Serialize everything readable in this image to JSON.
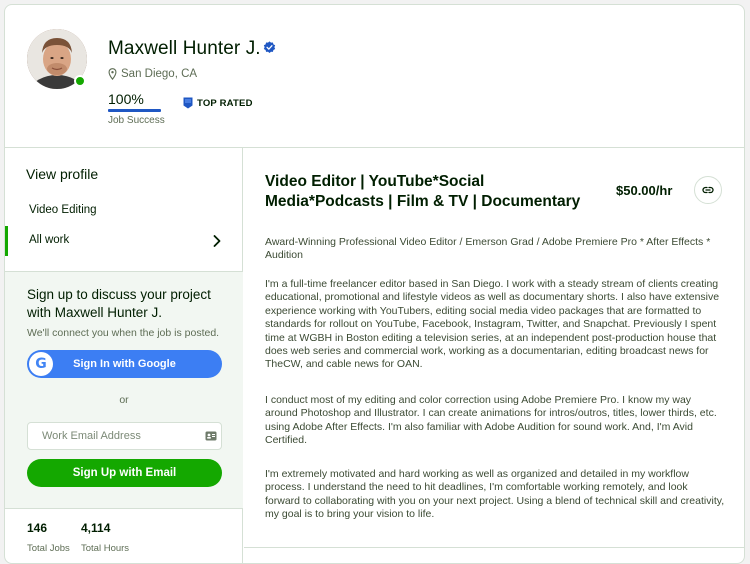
{
  "profile": {
    "name": "Maxwell Hunter J.",
    "location": "San Diego, CA",
    "job_success_pct": "100%",
    "job_success_value": 100,
    "job_success_label": "Job Success",
    "badge": "TOP RATED",
    "online": true
  },
  "sidebar": {
    "view_profile": "View profile",
    "items": [
      {
        "label": "Video Editing",
        "active": false
      },
      {
        "label": "All work",
        "active": true
      }
    ]
  },
  "signup": {
    "title": "Sign up to discuss your project with Maxwell Hunter J.",
    "subtitle": "We'll connect you when the job is posted.",
    "google_logo": "G",
    "google_button": "Sign In with Google",
    "or": "or",
    "email_placeholder": "Work Email Address",
    "email_value": "",
    "email_button": "Sign Up with Email"
  },
  "stats": [
    {
      "value": "146",
      "label": "Total Jobs"
    },
    {
      "value": "4,114",
      "label": "Total Hours"
    }
  ],
  "main": {
    "title": "Video Editor | YouTube*Social Media*Podcasts | Film & TV | Documentary",
    "rate": "$50.00/hr",
    "summary": "Award-Winning Professional Video Editor / Emerson Grad / Adobe Premiere Pro * After Effects * Audition",
    "paragraphs": [
      "I'm a full-time freelancer editor based in San Diego. I work with a steady stream of clients creating educational, promotional and lifestyle videos as well as documentary shorts. I also have extensive experience working with YouTubers, editing social media video packages that are formatted to standards for rollout on YouTube, Facebook, Instagram, Twitter, and Snapchat. Previously I spent time at WGBH in Boston editing a television series, at an independent post-production house that does web series and commercial work, working as a documentarian, editing broadcast news for TheCW, and cable news for OAN.",
      "I conduct most of my editing and color correction using Adobe Premiere Pro. I know my way around Photoshop and Illustrator. I can create animations for intros/outros, titles, lower thirds, etc. using Adobe After Effects. I'm also familiar with Adobe Audition for sound work. And, I'm Avid Certified.",
      "I'm extremely motivated and hard working as well as organized and detailed in my workflow process. I understand the need to hit deadlines, I'm comfortable working remotely, and look forward to collaborating with you on your next project. Using a blend of technical skill and creativity, my goal is to bring your vision to life."
    ]
  },
  "colors": {
    "accent_green": "#14a800",
    "job_success_blue": "#1f57c3",
    "google_blue": "#3c7ef3",
    "verified_blue": "#1f57c3"
  },
  "icons": {
    "verified": "verified-badge-icon",
    "location": "map-pin-icon",
    "top_rated": "top-rated-badge-icon",
    "chevron": "chevron-right-icon",
    "google": "google-logo-icon",
    "field": "contact-card-icon",
    "link": "link-icon"
  }
}
